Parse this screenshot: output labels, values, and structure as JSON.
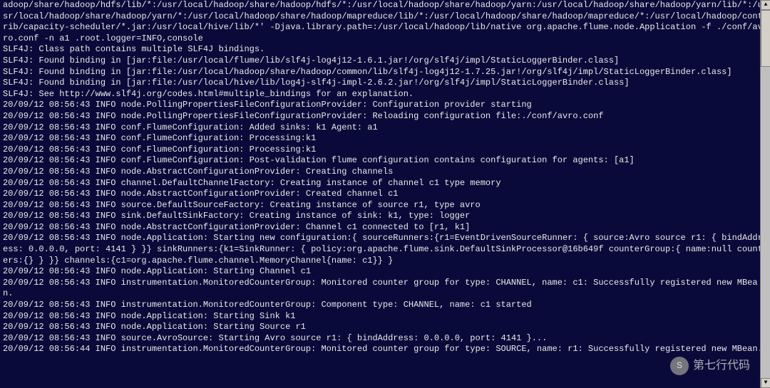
{
  "terminal": {
    "lines": [
      "adoop/share/hadoop/hdfs/lib/*:/usr/local/hadoop/share/hadoop/hdfs/*:/usr/local/hadoop/share/hadoop/yarn:/usr/local/hadoop/share/hadoop/yarn/lib/*:/usr/local/hadoop/share/hadoop/yarn/*:/usr/local/hadoop/share/hadoop/mapreduce/lib/*:/usr/local/hadoop/share/hadoop/mapreduce/*:/usr/local/hadoop/contrib/capacity-scheduler/*.jar:/usr/local/hive/lib/*' -Djava.library.path=:/usr/local/hadoop/lib/native org.apache.flume.node.Application -f ./conf/avro.conf -n a1 .root.logger=INFO,console",
      "SLF4J: Class path contains multiple SLF4J bindings.",
      "SLF4J: Found binding in [jar:file:/usr/local/flume/lib/slf4j-log4j12-1.6.1.jar!/org/slf4j/impl/StaticLoggerBinder.class]",
      "SLF4J: Found binding in [jar:file:/usr/local/hadoop/share/hadoop/common/lib/slf4j-log4j12-1.7.25.jar!/org/slf4j/impl/StaticLoggerBinder.class]",
      "SLF4J: Found binding in [jar:file:/usr/local/hive/lib/log4j-slf4j-impl-2.6.2.jar!/org/slf4j/impl/StaticLoggerBinder.class]",
      "SLF4J: See http://www.slf4j.org/codes.html#multiple_bindings for an explanation.",
      "20/09/12 08:56:43 INFO node.PollingPropertiesFileConfigurationProvider: Configuration provider starting",
      "20/09/12 08:56:43 INFO node.PollingPropertiesFileConfigurationProvider: Reloading configuration file:./conf/avro.conf",
      "20/09/12 08:56:43 INFO conf.FlumeConfiguration: Added sinks: k1 Agent: a1",
      "20/09/12 08:56:43 INFO conf.FlumeConfiguration: Processing:k1",
      "20/09/12 08:56:43 INFO conf.FlumeConfiguration: Processing:k1",
      "20/09/12 08:56:43 INFO conf.FlumeConfiguration: Post-validation flume configuration contains configuration for agents: [a1]",
      "20/09/12 08:56:43 INFO node.AbstractConfigurationProvider: Creating channels",
      "20/09/12 08:56:43 INFO channel.DefaultChannelFactory: Creating instance of channel c1 type memory",
      "20/09/12 08:56:43 INFO node.AbstractConfigurationProvider: Created channel c1",
      "20/09/12 08:56:43 INFO source.DefaultSourceFactory: Creating instance of source r1, type avro",
      "20/09/12 08:56:43 INFO sink.DefaultSinkFactory: Creating instance of sink: k1, type: logger",
      "20/09/12 08:56:43 INFO node.AbstractConfigurationProvider: Channel c1 connected to [r1, k1]",
      "20/09/12 08:56:43 INFO node.Application: Starting new configuration:{ sourceRunners:{r1=EventDrivenSourceRunner: { source:Avro source r1: { bindAddress: 0.0.0.0, port: 4141 } }} sinkRunners:{k1=SinkRunner: { policy:org.apache.flume.sink.DefaultSinkProcessor@16b649f counterGroup:{ name:null counters:{} } }} channels:{c1=org.apache.flume.channel.MemoryChannel{name: c1}} }",
      "20/09/12 08:56:43 INFO node.Application: Starting Channel c1",
      "20/09/12 08:56:43 INFO instrumentation.MonitoredCounterGroup: Monitored counter group for type: CHANNEL, name: c1: Successfully registered new MBean.",
      "20/09/12 08:56:43 INFO instrumentation.MonitoredCounterGroup: Component type: CHANNEL, name: c1 started",
      "20/09/12 08:56:43 INFO node.Application: Starting Sink k1",
      "20/09/12 08:56:43 INFO node.Application: Starting Source r1",
      "20/09/12 08:56:43 INFO source.AvroSource: Starting Avro source r1: { bindAddress: 0.0.0.0, port: 4141 }...",
      "20/09/12 08:56:44 INFO instrumentation.MonitoredCounterGroup: Monitored counter group for type: SOURCE, name: r1: Successfully registered new MBean."
    ]
  },
  "watermark": {
    "text": "第七行代码",
    "badgeText": "S"
  },
  "scrollbar": {
    "upLabel": "▲",
    "downLabel": "▼"
  }
}
